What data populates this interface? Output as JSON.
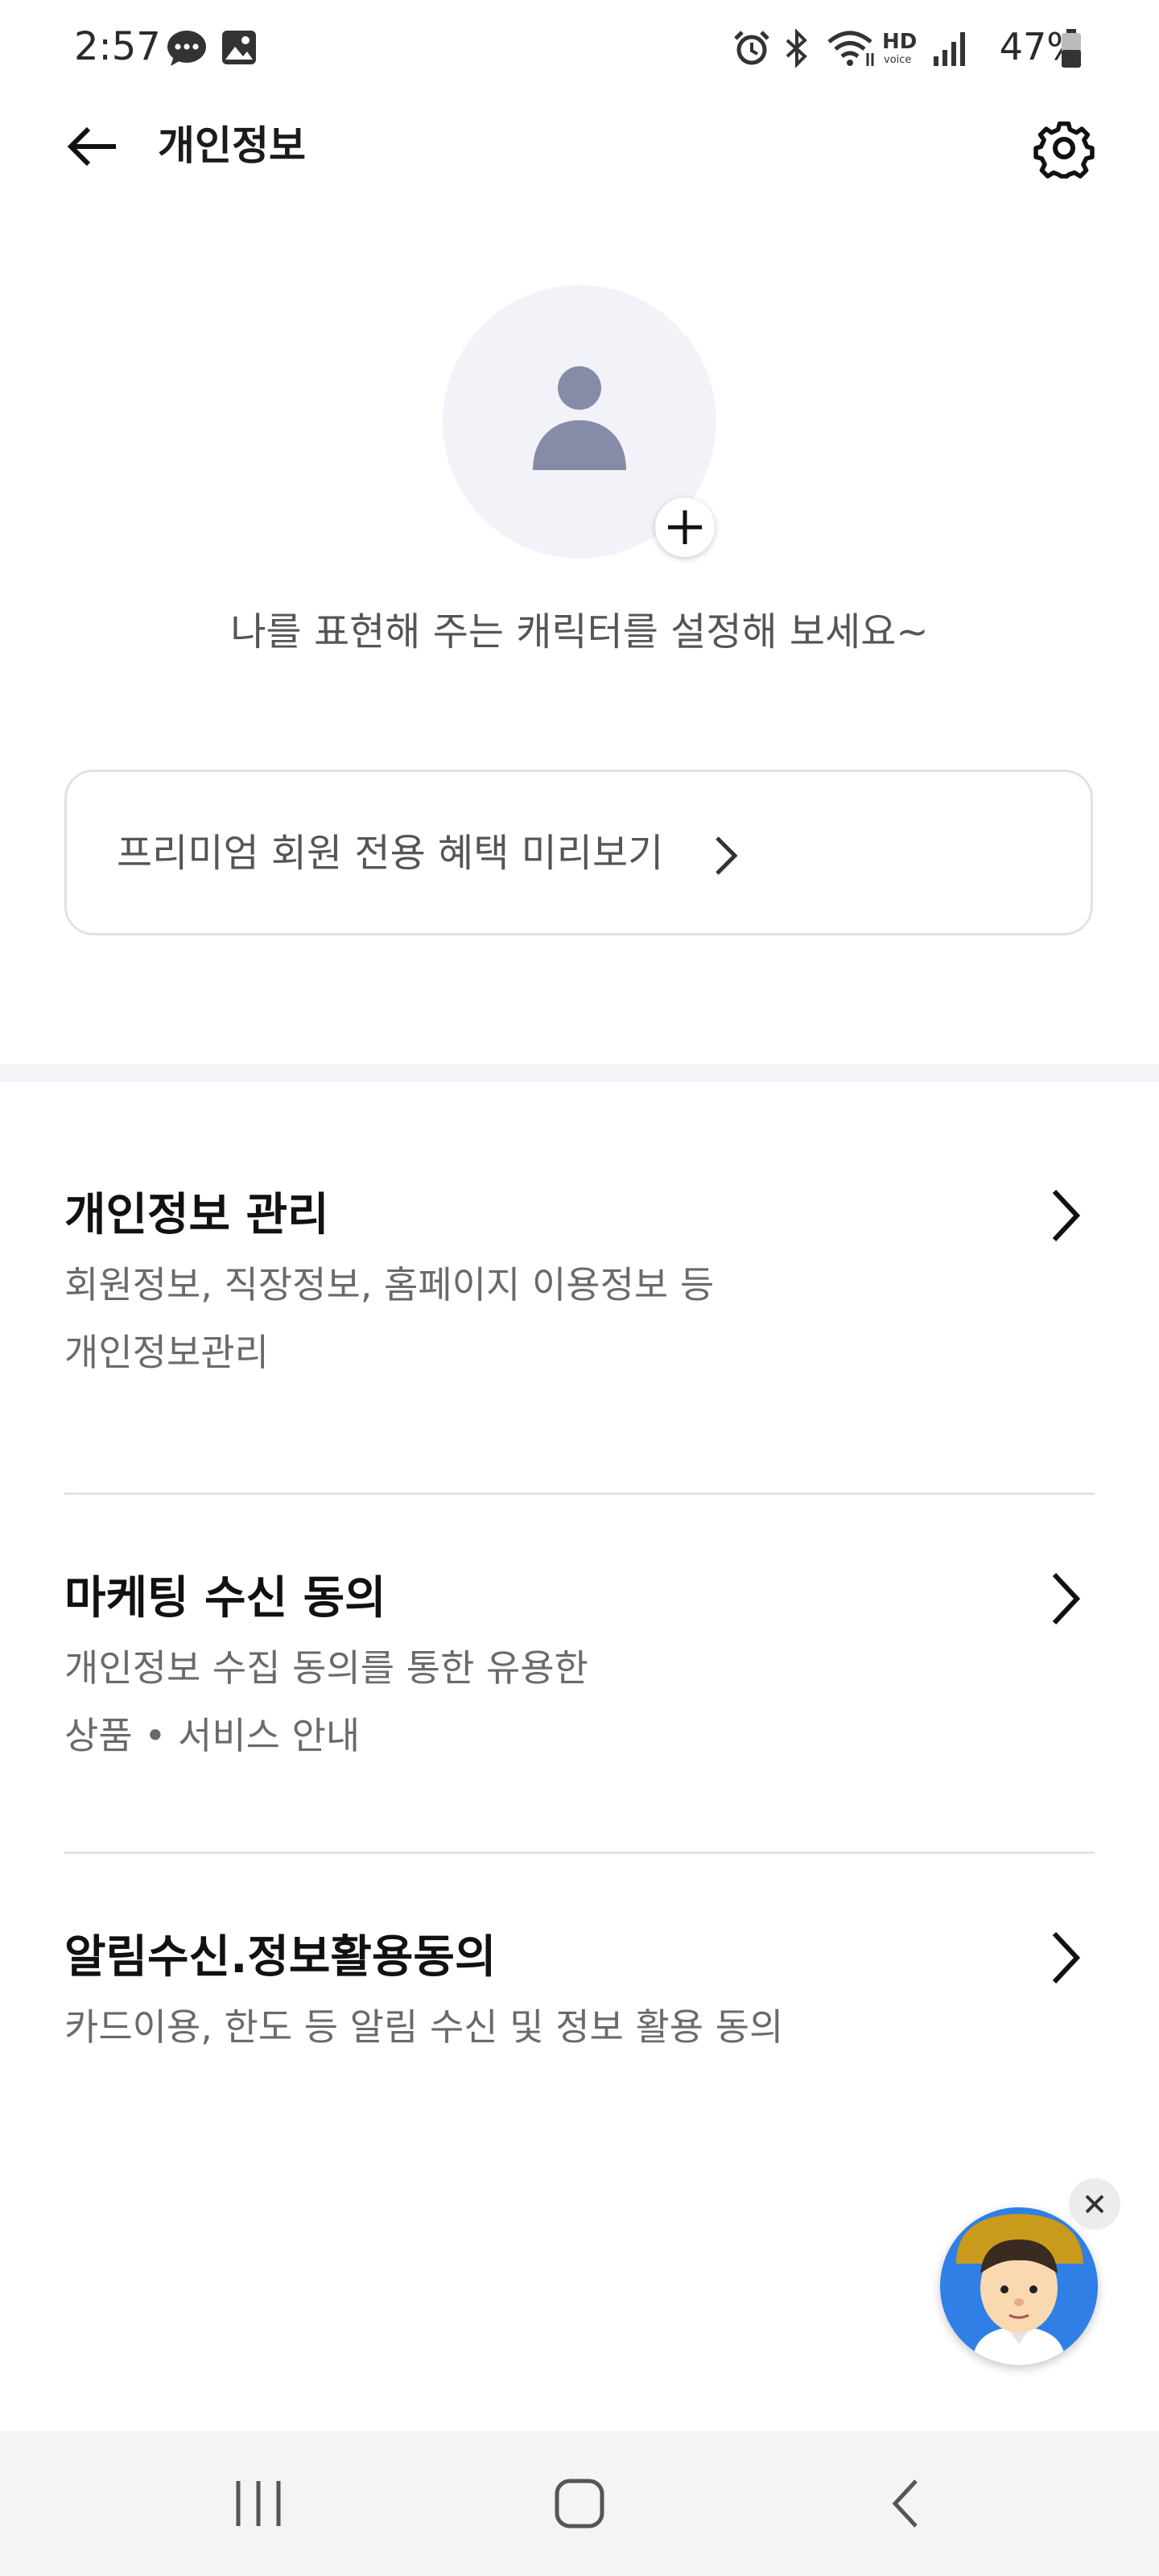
{
  "status_bar": {
    "time": "2:57",
    "battery": "47%"
  },
  "header": {
    "title": "개인정보"
  },
  "profile": {
    "caption": "나를 표현해 주는 캐릭터를 설정해 보세요~"
  },
  "premium": {
    "label": "프리미엄 회원 전용 혜택 미리보기"
  },
  "menu": [
    {
      "title": "개인정보 관리",
      "desc_line1": "회원정보, 직장정보, 홈페이지 이용정보 등",
      "desc_line2": "개인정보관리"
    },
    {
      "title": "마케팅 수신 동의",
      "desc_line1": "개인정보 수집 동의를 통한 유용한",
      "desc_line2": "상품 • 서비스 안내"
    },
    {
      "title": "알림수신.정보활용동의",
      "desc_line1": "카드이용, 한도 등 알림 수신 및 정보 활용 동의"
    }
  ],
  "icons": {
    "back": "back-arrow-icon",
    "settings": "gear-icon",
    "add": "plus-icon",
    "chevron": "chevron-right-icon",
    "close": "close-icon"
  },
  "colors": {
    "avatar_bg": "#f2f3f9",
    "avatar_figure": "#868ca8",
    "divider": "#e2e2e6"
  }
}
